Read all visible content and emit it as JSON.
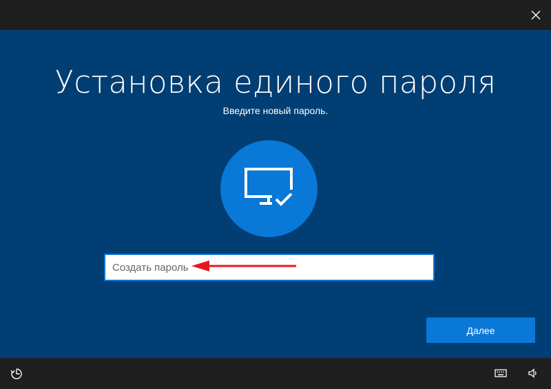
{
  "window": {
    "close_icon": "close-icon"
  },
  "main": {
    "title": "Установка единого пароля",
    "subtitle": "Введите новый пароль.",
    "avatar_icon": "monitor-check-icon",
    "password": {
      "value": "",
      "placeholder": "Создать пароль"
    },
    "next_label": "Далее",
    "annotation_color": "#e8161f"
  },
  "taskbar": {
    "icons": [
      "ease-of-access-icon",
      "keyboard-icon",
      "volume-icon"
    ]
  },
  "colors": {
    "background": "#003e73",
    "accent": "#0a78d7",
    "chrome": "#1f1f1f"
  }
}
